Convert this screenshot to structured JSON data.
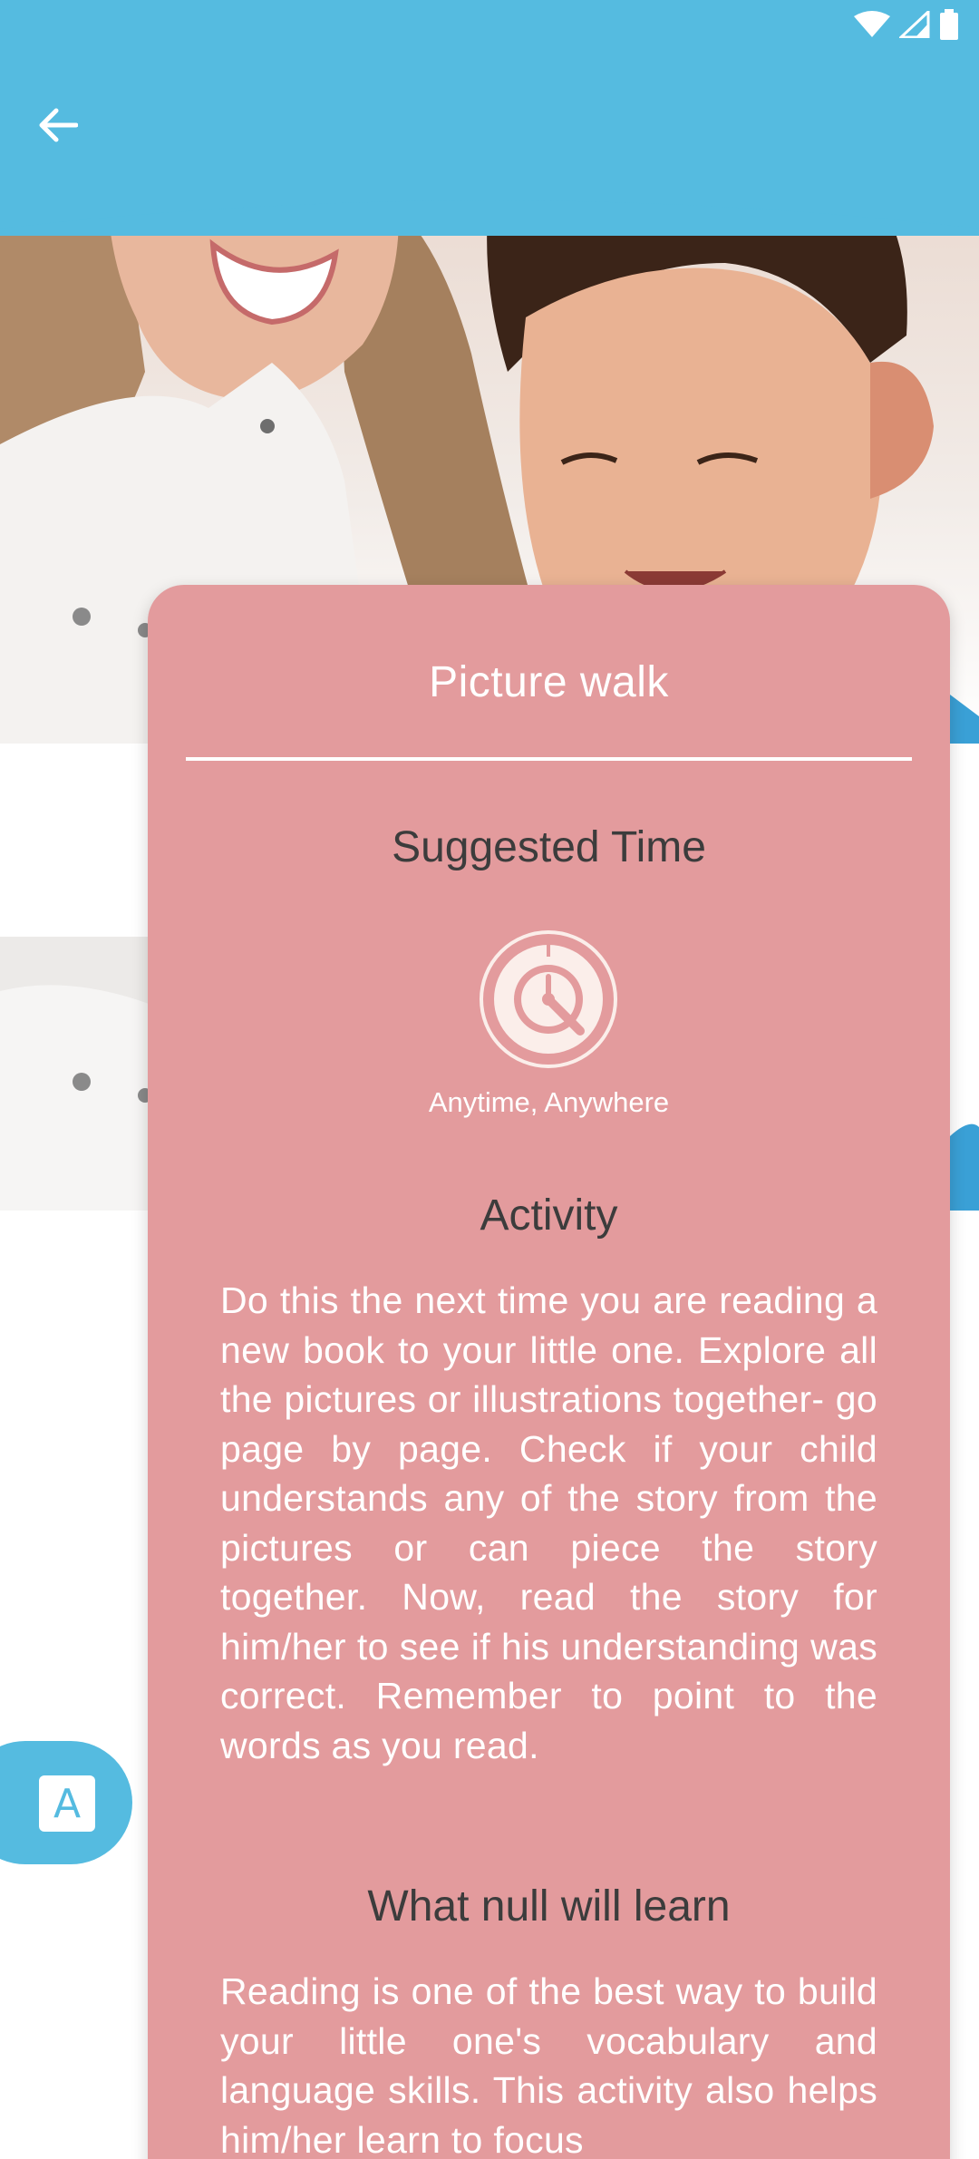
{
  "header": {
    "back_icon": "arrow-left-icon",
    "background_color": "#55bbe0"
  },
  "status_bar": {
    "icons": [
      "wifi-icon",
      "cellular-signal-icon",
      "battery-icon"
    ]
  },
  "card": {
    "background_color": "#e39b9d",
    "title": "Picture walk",
    "suggested_time": {
      "heading": "Suggested Time",
      "icon": "clock-icon",
      "value": "Anytime, Anywhere"
    },
    "activity": {
      "heading": "Activity",
      "text": "Do this the next time you are reading a new book to your little one. Explore all the pictures or illustrations together- go page by page. Check if your child understands any of the story from the pictures or can piece the story together. Now, read the story for him/her to see if his understanding was correct. Remember to point to the words as you read."
    },
    "learn": {
      "heading": "What null will learn",
      "text": "Reading is one of the best way to build your little one's vocabulary and language skills. This activity also helps him/her learn to focus"
    }
  },
  "font_button": {
    "label": "A",
    "icon": "font-size-icon"
  }
}
